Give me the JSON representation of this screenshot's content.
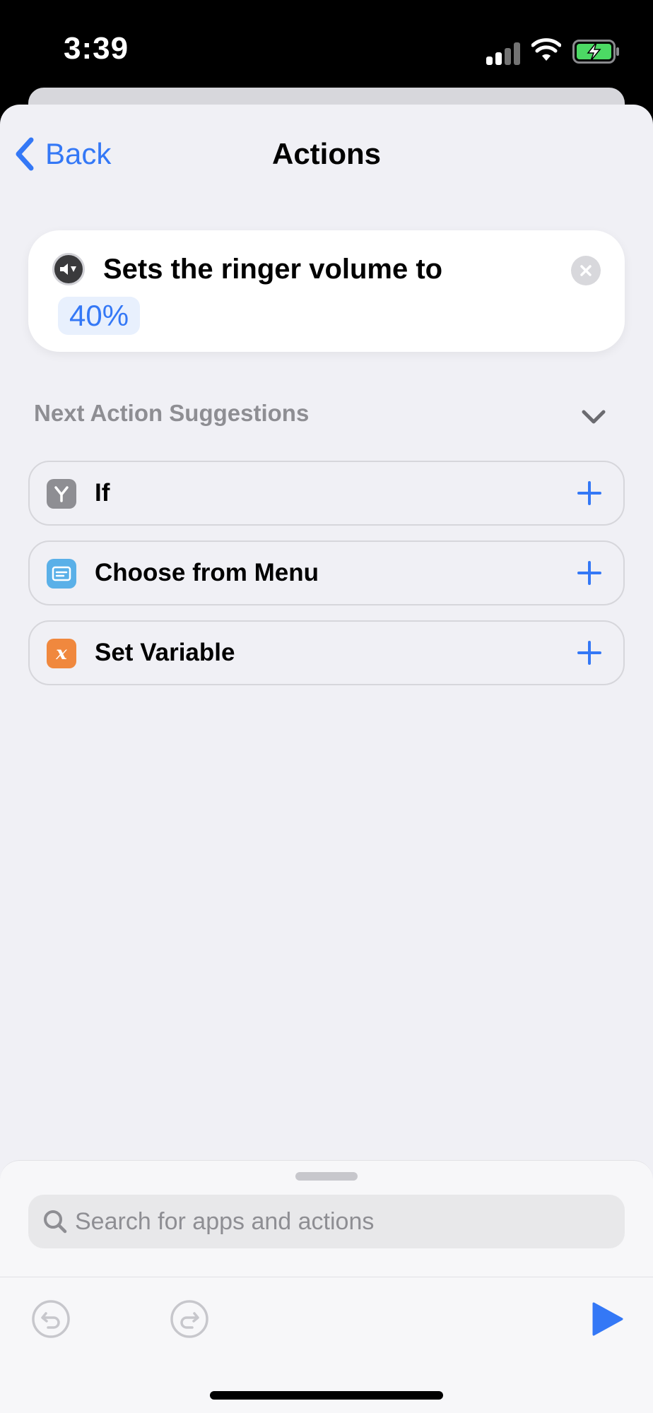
{
  "status_bar": {
    "time": "3:39",
    "signal_icon": "cellular-signal-icon",
    "wifi_icon": "wifi-icon",
    "battery_icon": "battery-charging-icon",
    "battery_color": "#4cd964"
  },
  "nav": {
    "back_label": "Back",
    "title": "Actions"
  },
  "action": {
    "icon": "speaker-volume-icon",
    "text": "Sets the ringer volume to",
    "value": "40%"
  },
  "suggestions": {
    "header": "Next Action Suggestions",
    "items": [
      {
        "label": "If",
        "icon": "if-branch-icon",
        "color": "#8e8e93"
      },
      {
        "label": "Choose from Menu",
        "icon": "menu-icon",
        "color": "#5ab0e8"
      },
      {
        "label": "Set Variable",
        "icon": "variable-icon",
        "color": "#f0883e"
      }
    ]
  },
  "bottom": {
    "search_placeholder": "Search for apps and actions"
  },
  "colors": {
    "accent": "#3478f6",
    "background": "#f0f0f5"
  }
}
